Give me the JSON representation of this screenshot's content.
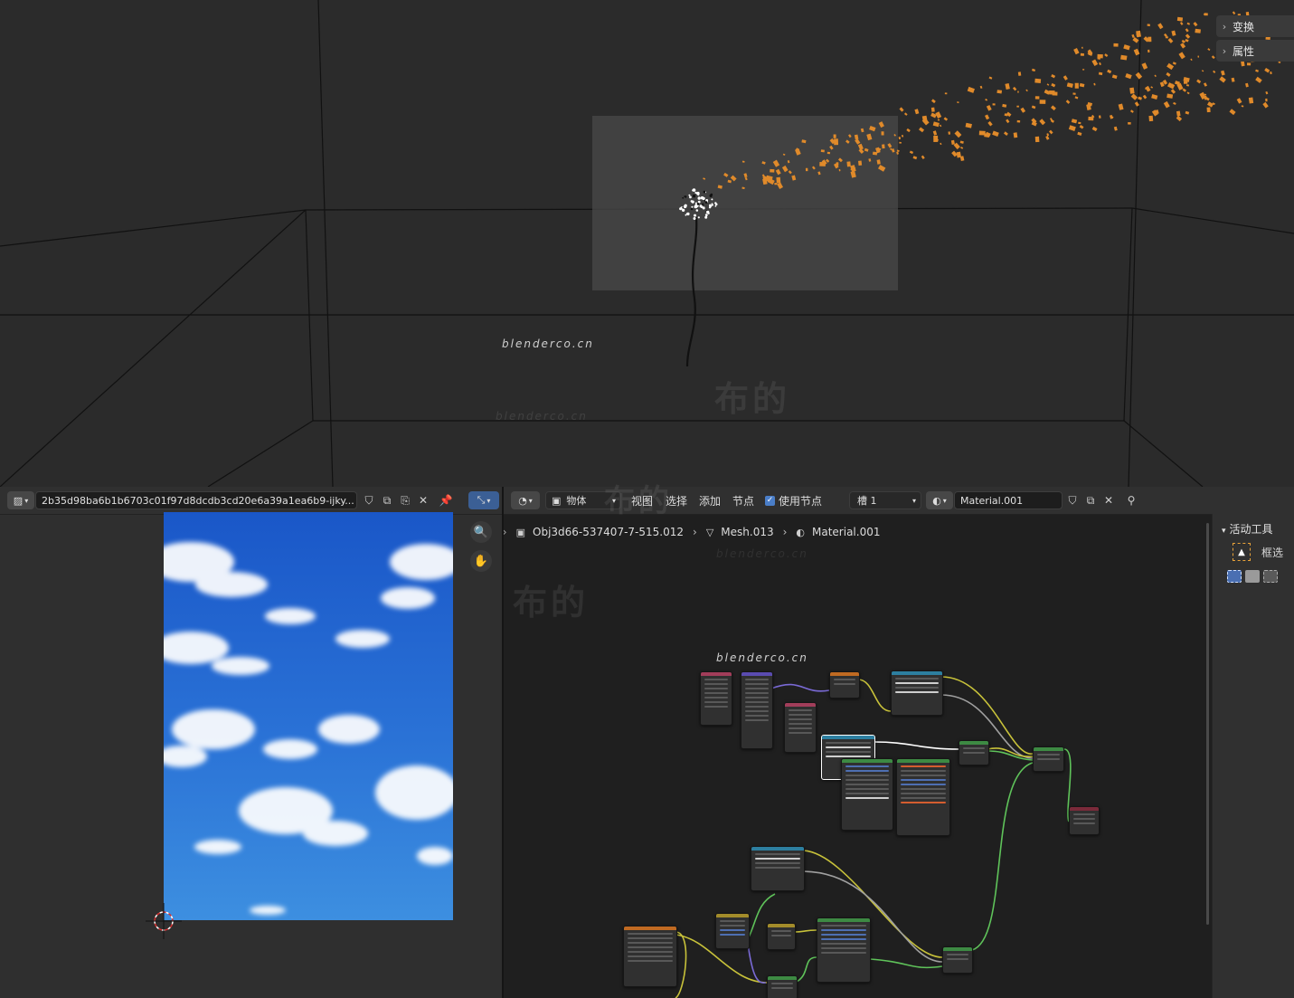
{
  "viewport": {
    "panels": [
      {
        "label": "变换"
      },
      {
        "label": "属性"
      }
    ],
    "watermark_url": "blenderco.cn",
    "watermark_url_faint": "blenderco.cn",
    "watermark_brand": "布的"
  },
  "image_editor": {
    "image_name": "2b35d98ba6b1b6703c01f97d8dcdb3cd20e6a39a1ea6b9-ijky...",
    "colors": {
      "sky_top": "#1a57c8",
      "sky_bottom": "#3d8fe0"
    }
  },
  "node_editor": {
    "header": {
      "mode": "物体",
      "menus": [
        "视图",
        "选择",
        "添加",
        "节点"
      ],
      "use_nodes_label": "使用节点",
      "slot": "槽 1",
      "material": "Material.001"
    },
    "breadcrumb": {
      "object": "Obj3d66-537407-7-515.012",
      "mesh": "Mesh.013",
      "material": "Material.001"
    },
    "watermark_url": "blenderco.cn",
    "watermark_url_faint": "blenderco.cn",
    "watermark_brand": "布的",
    "tool_panel": {
      "title": "活动工具",
      "tool": "框选"
    }
  },
  "header_watermark_brand": "布的",
  "colors": {
    "accent_blue": "#4a7ec8",
    "particle_orange": "#e08a2a",
    "link_yellow": "#c8c23a",
    "link_green": "#5fc35a",
    "link_purple": "#7a6ad6",
    "link_gray": "#a0a0a0"
  }
}
